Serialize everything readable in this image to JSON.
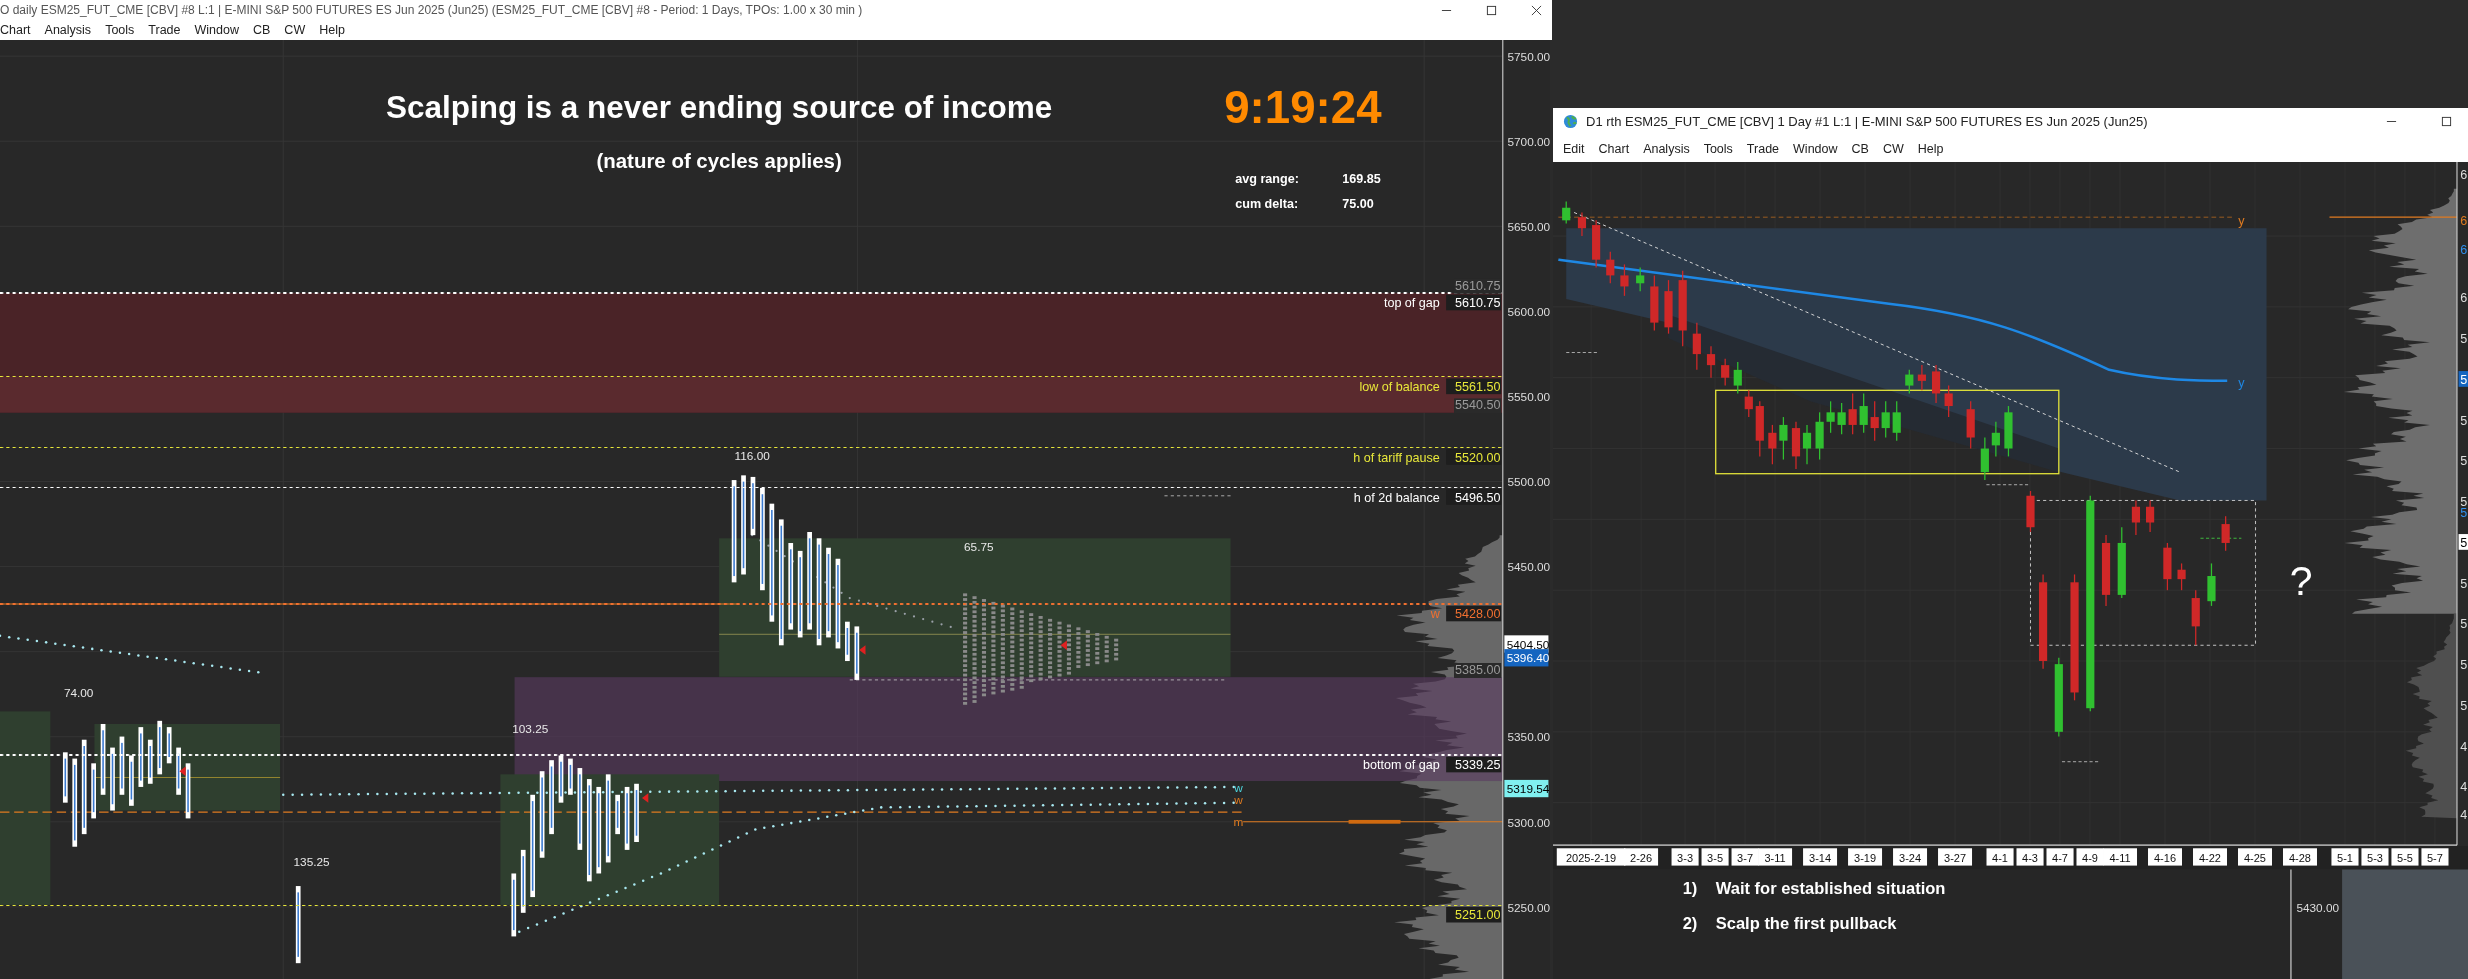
{
  "left_window": {
    "title": "O daily ESM25_FUT_CME [CBV] #8 L:1 | E-MINI S&P 500 FUTURES ES Jun 2025 (Jun25) (ESM25_FUT_CME [CBV] #8 - Period: 1 Days, TPOs: 1.00 x 30 min  )",
    "menu": [
      "Chart",
      "Analysis",
      "Tools",
      "Trade",
      "Window",
      "CB",
      "CW",
      "Help"
    ],
    "headline": "Scalping is a never ending source of income",
    "subheadline": "(nature of cycles applies)",
    "clock": "9:19:24",
    "stats": [
      {
        "label": "avg range:",
        "value": "169.85"
      },
      {
        "label": "cum delta:",
        "value": "75.00"
      }
    ],
    "price_axis": [
      "5750.00",
      "5700.00",
      "5650.00",
      "5600.00",
      "5550.00",
      "5500.00",
      "5450.00",
      "5350.00",
      "5300.00",
      "5250.00"
    ],
    "price_tags": [
      {
        "text": "5404.50",
        "kind": "last"
      },
      {
        "text": "5396.40",
        "kind": "blue"
      },
      {
        "text": "5319.54",
        "kind": "cyan"
      }
    ],
    "levels": [
      {
        "label": "top of gap",
        "price": "5610.75",
        "color": "#ffffff"
      },
      {
        "label": "low of balance",
        "price": "5561.50",
        "color": "#e8e83a"
      },
      {
        "label": "h of tariff pause",
        "price": "5520.00",
        "color": "#e8e83a"
      },
      {
        "label": "h of 2d balance",
        "price": "5496.50",
        "color": "#ffffff"
      },
      {
        "label": "w",
        "price": "5428.00",
        "color": "#f07030"
      },
      {
        "label": "bottom of gap",
        "price": "5339.25",
        "color": "#ffffff"
      },
      {
        "price": "5251.00",
        "color": "#e8e83a"
      }
    ],
    "ghost_prices": [
      "5610.75",
      "5540.50",
      "5385.00"
    ],
    "range_labels": [
      "116.00",
      "65.75",
      "74.00",
      "103.25",
      "135.25"
    ],
    "line_markers": [
      {
        "text": "w",
        "color": "#4dd8e0"
      },
      {
        "text": "w",
        "color": "#e07b20"
      },
      {
        "text": "m",
        "color": "#e07b20"
      }
    ]
  },
  "right_window": {
    "title": "D1 rth ESM25_FUT_CME [CBV]  1 Day  #1 L:1 | E-MINI S&P 500 FUTURES ES Jun 2025 (Jun25)",
    "menu": [
      "Edit",
      "Chart",
      "Analysis",
      "Tools",
      "Trade",
      "Window",
      "CB",
      "CW",
      "Help"
    ],
    "date_axis": [
      "2025-2-19",
      "2-26",
      "3-3",
      "3-5",
      "3-7",
      "3-11",
      "3-14",
      "3-19",
      "3-24",
      "3-27",
      "4-1",
      "4-3",
      "4-7",
      "4-9",
      "4-11",
      "4-16",
      "4-22",
      "4-25",
      "4-28",
      "5-1",
      "5-3",
      "5-5",
      "5-7"
    ],
    "price_axis": [
      {
        "text": "6",
        "kind": "plain"
      },
      {
        "text": "6",
        "kind": "orange"
      },
      {
        "text": "6",
        "kind": "blue"
      },
      {
        "text": "6",
        "kind": "plain"
      },
      {
        "text": "5",
        "kind": "plain"
      },
      {
        "text": "5",
        "kind": "blue_tag"
      },
      {
        "text": "5",
        "kind": "plain"
      },
      {
        "text": "5",
        "kind": "plain"
      },
      {
        "text": "5",
        "kind": "plain"
      },
      {
        "text": "5",
        "kind": "blue"
      },
      {
        "text": "5",
        "kind": "white_tag"
      },
      {
        "text": "5",
        "kind": "plain"
      },
      {
        "text": "5",
        "kind": "plain"
      },
      {
        "text": "5",
        "kind": "plain"
      },
      {
        "text": "5",
        "kind": "plain"
      },
      {
        "text": "4",
        "kind": "plain"
      },
      {
        "text": "4",
        "kind": "plain"
      },
      {
        "text": "4",
        "kind": "plain"
      }
    ],
    "markers": [
      {
        "text": "y",
        "color": "#e07b20"
      },
      {
        "text": "y",
        "color": "#1e88e5"
      }
    ],
    "annotation": "?"
  },
  "notes": [
    {
      "number": "1)",
      "text": "Wait for established situation"
    },
    {
      "number": "2)",
      "text": "Scalp the first pullback"
    }
  ],
  "back_axis_label": "5430.00"
}
